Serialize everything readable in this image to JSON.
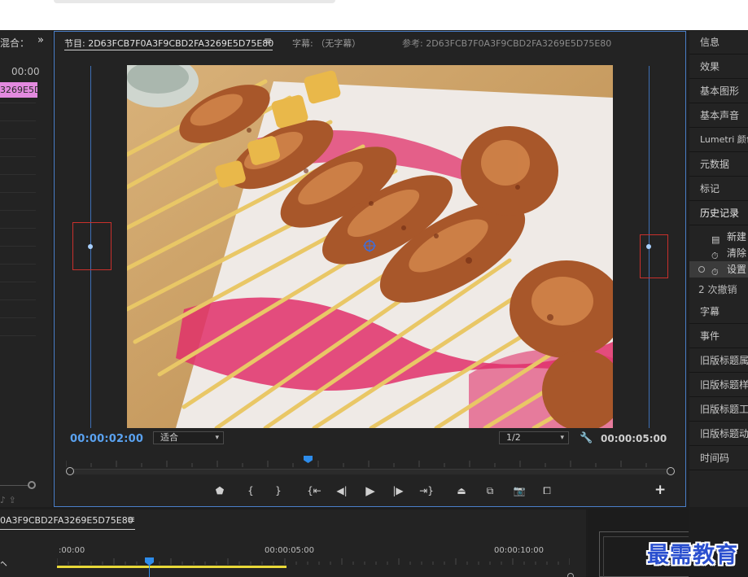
{
  "left_panel": {
    "tab_label": "混合：",
    "timecode": "00:00",
    "clip_label": "3269E5D"
  },
  "program_monitor": {
    "tab_label": "节目: 2D63FCB7F0A3F9CBD2FA3269E5D75E80",
    "menu_glyph": "≡",
    "caption_tab": "字幕: （无字幕）",
    "reference_tab": "参考: 2D63FCB7F0A3F9CBD2FA3269E5D75E80",
    "current_timecode": "00:00:02:00",
    "zoom_select": "适合",
    "resolution_select": "1/2",
    "duration_timecode": "00:00:05:00",
    "playhead_fraction": 0.395
  },
  "transport_icons": [
    "marker-icon",
    "mark-in-icon",
    "mark-out-icon",
    "go-to-in-icon",
    "step-back-icon",
    "play-icon",
    "step-forward-icon",
    "go-to-out-icon",
    "lift-icon",
    "extract-icon",
    "export-frame-icon",
    "compare-icon"
  ],
  "right_panel": {
    "items": [
      {
        "label": "信息"
      },
      {
        "label": "效果"
      },
      {
        "label": "基本图形"
      },
      {
        "label": "基本声音"
      },
      {
        "label": "Lumetri 颜色"
      },
      {
        "label": "元数据"
      },
      {
        "label": "标记"
      },
      {
        "label": "历史记录"
      }
    ],
    "history_rows": [
      {
        "label": "新建"
      },
      {
        "label": "清除"
      },
      {
        "label": "设置"
      }
    ],
    "undo_label": "2 次撤销",
    "items_after": [
      {
        "label": "字幕"
      },
      {
        "label": "事件"
      },
      {
        "label": "旧版标题属性"
      },
      {
        "label": "旧版标题样式"
      },
      {
        "label": "旧版标题工具"
      },
      {
        "label": "旧版标题动作"
      },
      {
        "label": "时间码"
      }
    ]
  },
  "timeline": {
    "tab_label": "0A3F9CBD2FA3269E5D75E80",
    "menu_glyph": "≡",
    "times": [
      ":00:00",
      "00:00:05:00",
      "00:00:10:00"
    ]
  },
  "watermark": "最需教育",
  "colors": {
    "accent_blue": "#2d8ceb",
    "clip_pink": "#e38adf",
    "work_area_yellow": "#e8d838",
    "guide_red": "#c9302c"
  }
}
